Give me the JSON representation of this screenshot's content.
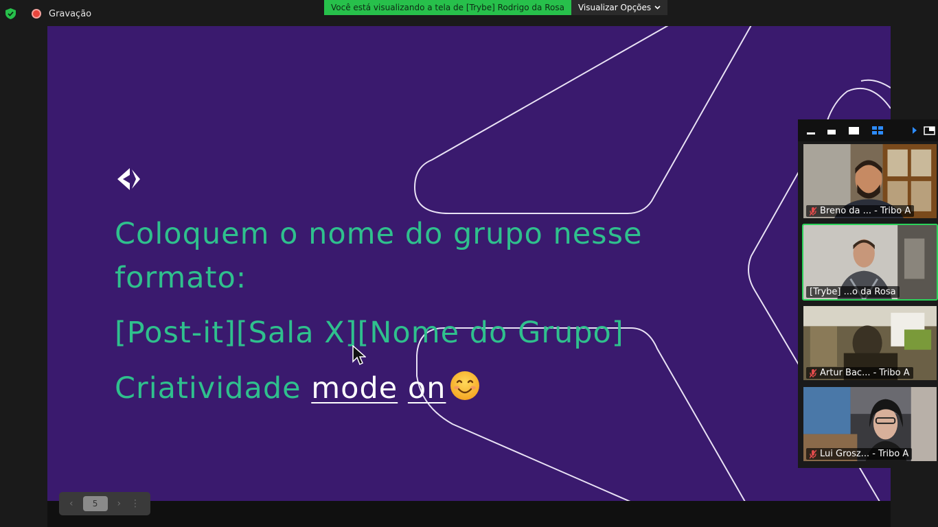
{
  "recording": {
    "label": "Gravação"
  },
  "share_banner": {
    "text": "Você está visualizando a tela de [Trybe] Rodrigo da Rosa",
    "options_label": "Visualizar Opções"
  },
  "slide": {
    "line1": "Coloquem o nome do grupo nesse",
    "line2": "formato:",
    "line3": "[Post-it][Sala X][Nome do Grupo]",
    "line4_prefix": "Criatividade ",
    "line4_word1": "mode",
    "line4_word2": "on",
    "emoji_icon": "smiling-face-icon",
    "text_color": "#2fc08d",
    "background_color": "#3a1a6e"
  },
  "page_nav": {
    "current_page": "5"
  },
  "gallery": {
    "participants": [
      {
        "name": "Breno da ... - Tribo A",
        "muted": true,
        "active": false
      },
      {
        "name": "[Trybe] ...o da Rosa",
        "muted": false,
        "active": true
      },
      {
        "name": "Artur Bac... - Tribo A",
        "muted": true,
        "active": false
      },
      {
        "name": "Lui Grosz... - Tribo A",
        "muted": true,
        "active": false
      }
    ]
  },
  "colors": {
    "accent_green": "#27c04b",
    "active_speaker": "#2bd35a",
    "recording_red": "#e8453c"
  }
}
